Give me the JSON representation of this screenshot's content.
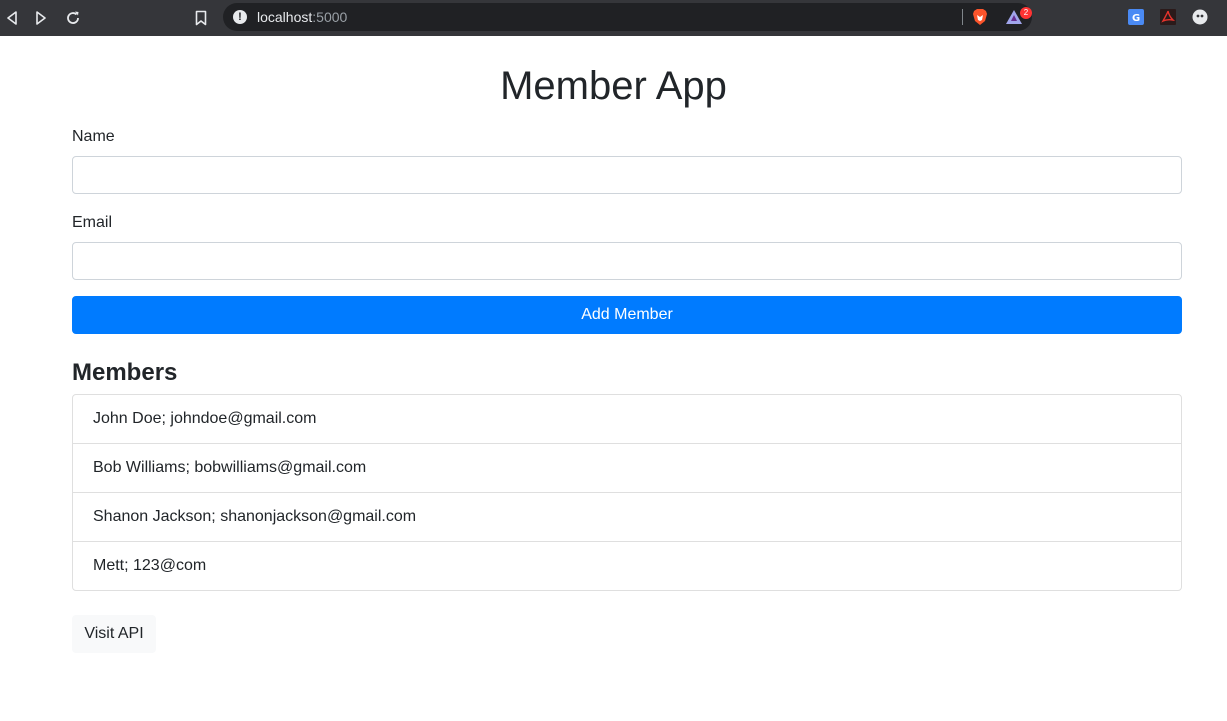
{
  "browser": {
    "url_host": "localhost",
    "url_port": ":5000",
    "rewards_badge": "2",
    "icons": [
      "back-icon",
      "forward-icon",
      "reload-icon",
      "bookmark-icon",
      "info-icon",
      "brave-shield-icon",
      "bat-rewards-icon",
      "translate-extension-icon",
      "pdf-extension-icon",
      "profile-extension-icon"
    ]
  },
  "app": {
    "title": "Member App"
  },
  "form": {
    "name_label": "Name",
    "name_value": "",
    "email_label": "Email",
    "email_value": "",
    "submit_label": "Add Member"
  },
  "members": {
    "heading": "Members",
    "items": [
      {
        "text": "John Doe; johndoe@gmail.com"
      },
      {
        "text": "Bob Williams; bobwilliams@gmail.com"
      },
      {
        "text": "Shanon Jackson; shanonjackson@gmail.com"
      },
      {
        "text": "Mett; 123@com"
      }
    ]
  },
  "api_link": {
    "label": "Visit API"
  },
  "colors": {
    "primary": "#007bff",
    "toolbar": "#35363a",
    "address_bar": "#202124"
  }
}
